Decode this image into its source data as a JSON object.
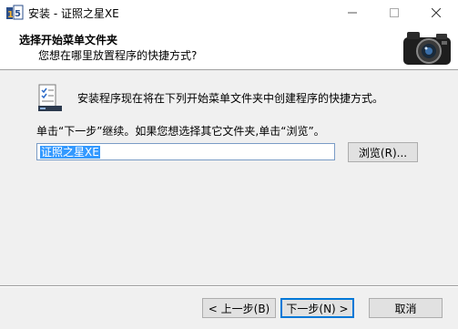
{
  "window": {
    "title": "安装 - 证照之星XE",
    "minimize_icon": "minimize-icon",
    "maximize_icon": "maximize-icon",
    "close_icon": "close-icon"
  },
  "header": {
    "title": "选择开始菜单文件夹",
    "subtitle": "您想在哪里放置程序的快捷方式?"
  },
  "body": {
    "intro_text": "安装程序现在将在下列开始菜单文件夹中创建程序的快捷方式。",
    "instruction_text": "单击“下一步”继续。如果您想选择其它文件夹,单击“浏览”。",
    "folder_value": "证照之星XE",
    "browse_label": "浏览(R)..."
  },
  "footer": {
    "back_label": "< 上一步(B)",
    "next_label": "下一步(N) >",
    "cancel_label": "取消"
  },
  "colors": {
    "selection": "#3399ff",
    "default_button_border": "#0078d7"
  }
}
